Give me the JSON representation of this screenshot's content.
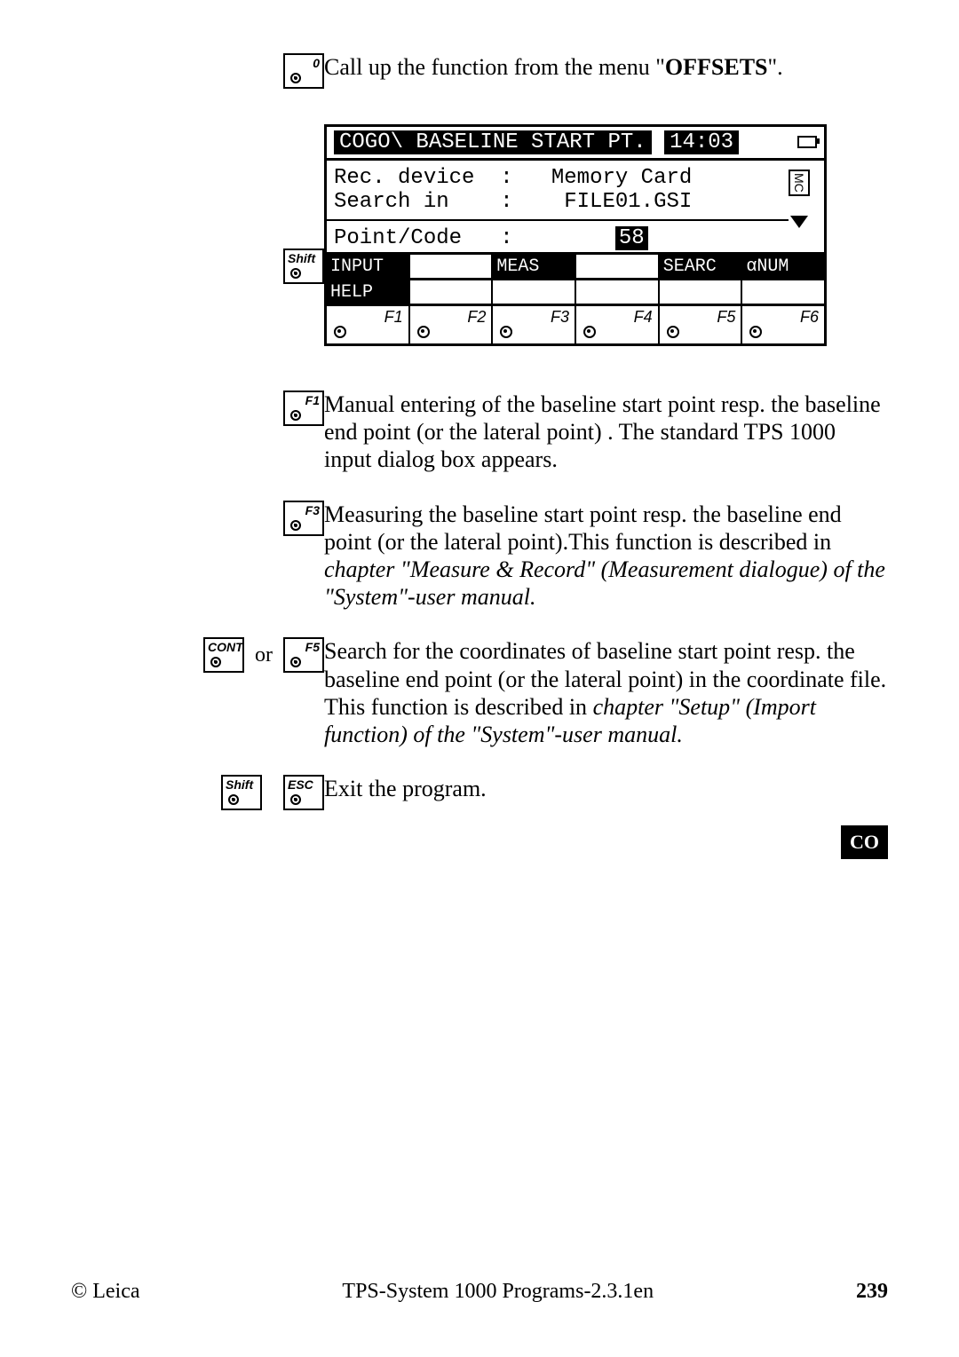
{
  "intro": {
    "key": "0",
    "text_pre": "Call up the function from the menu \"",
    "bold": "OFFSETS",
    "text_post": "\"."
  },
  "screen": {
    "shift_key": "Shift",
    "title": "COGO\\ BASELINE START PT.",
    "time": "14:03",
    "mc_label": "MC",
    "lines": {
      "l1_label": "Rec. device  :",
      "l1_val": "Memory Card",
      "l2_label": "Search in    :",
      "l2_val": "FILE01.GSI",
      "l3_label": "Point/Code   :",
      "l3_val": "58"
    },
    "softkeys_row1": [
      "INPUT",
      "",
      "MEAS",
      "",
      "SEARC",
      "αNUM"
    ],
    "softkeys_row2": [
      "HELP",
      "",
      "",
      "",
      "",
      ""
    ],
    "fn": [
      "F1",
      "F2",
      "F3",
      "F4",
      "F5",
      "F6"
    ]
  },
  "items": [
    {
      "keys": [
        {
          "label": "F1",
          "pos": "tr"
        }
      ],
      "text": "Manual entering of the baseline start point resp. the baseline end point (or the lateral point) . The standard TPS 1000 input dialog box appears."
    },
    {
      "keys": [
        {
          "label": "F3",
          "pos": "tr"
        }
      ],
      "text": "Measuring the baseline start point resp. the baseline end point (or the lateral point).This function is described in ",
      "italic": "chapter \"Measure & Record\" (Measurement dialogue) of the \"System\"-user manual."
    },
    {
      "keys": [
        {
          "label": "CONT",
          "pos": "tl"
        },
        {
          "or": "or"
        },
        {
          "label": "F5",
          "pos": "tr"
        }
      ],
      "text": "Search for the coordinates of baseline start point resp. the baseline end point (or the lateral point) in the coordinate file. This function is described in ",
      "italic": "chapter \"Setup\" (Import function) of the \"System\"-user manual."
    },
    {
      "keys": [
        {
          "label": "Shift",
          "pos": "tl"
        },
        {
          "label": "ESC",
          "pos": "tl"
        }
      ],
      "text": "Exit the program."
    }
  ],
  "side_tab": "CO",
  "footer": {
    "left": "© Leica",
    "center": "TPS-System 1000 Programs-2.3.1en",
    "page": "239"
  }
}
